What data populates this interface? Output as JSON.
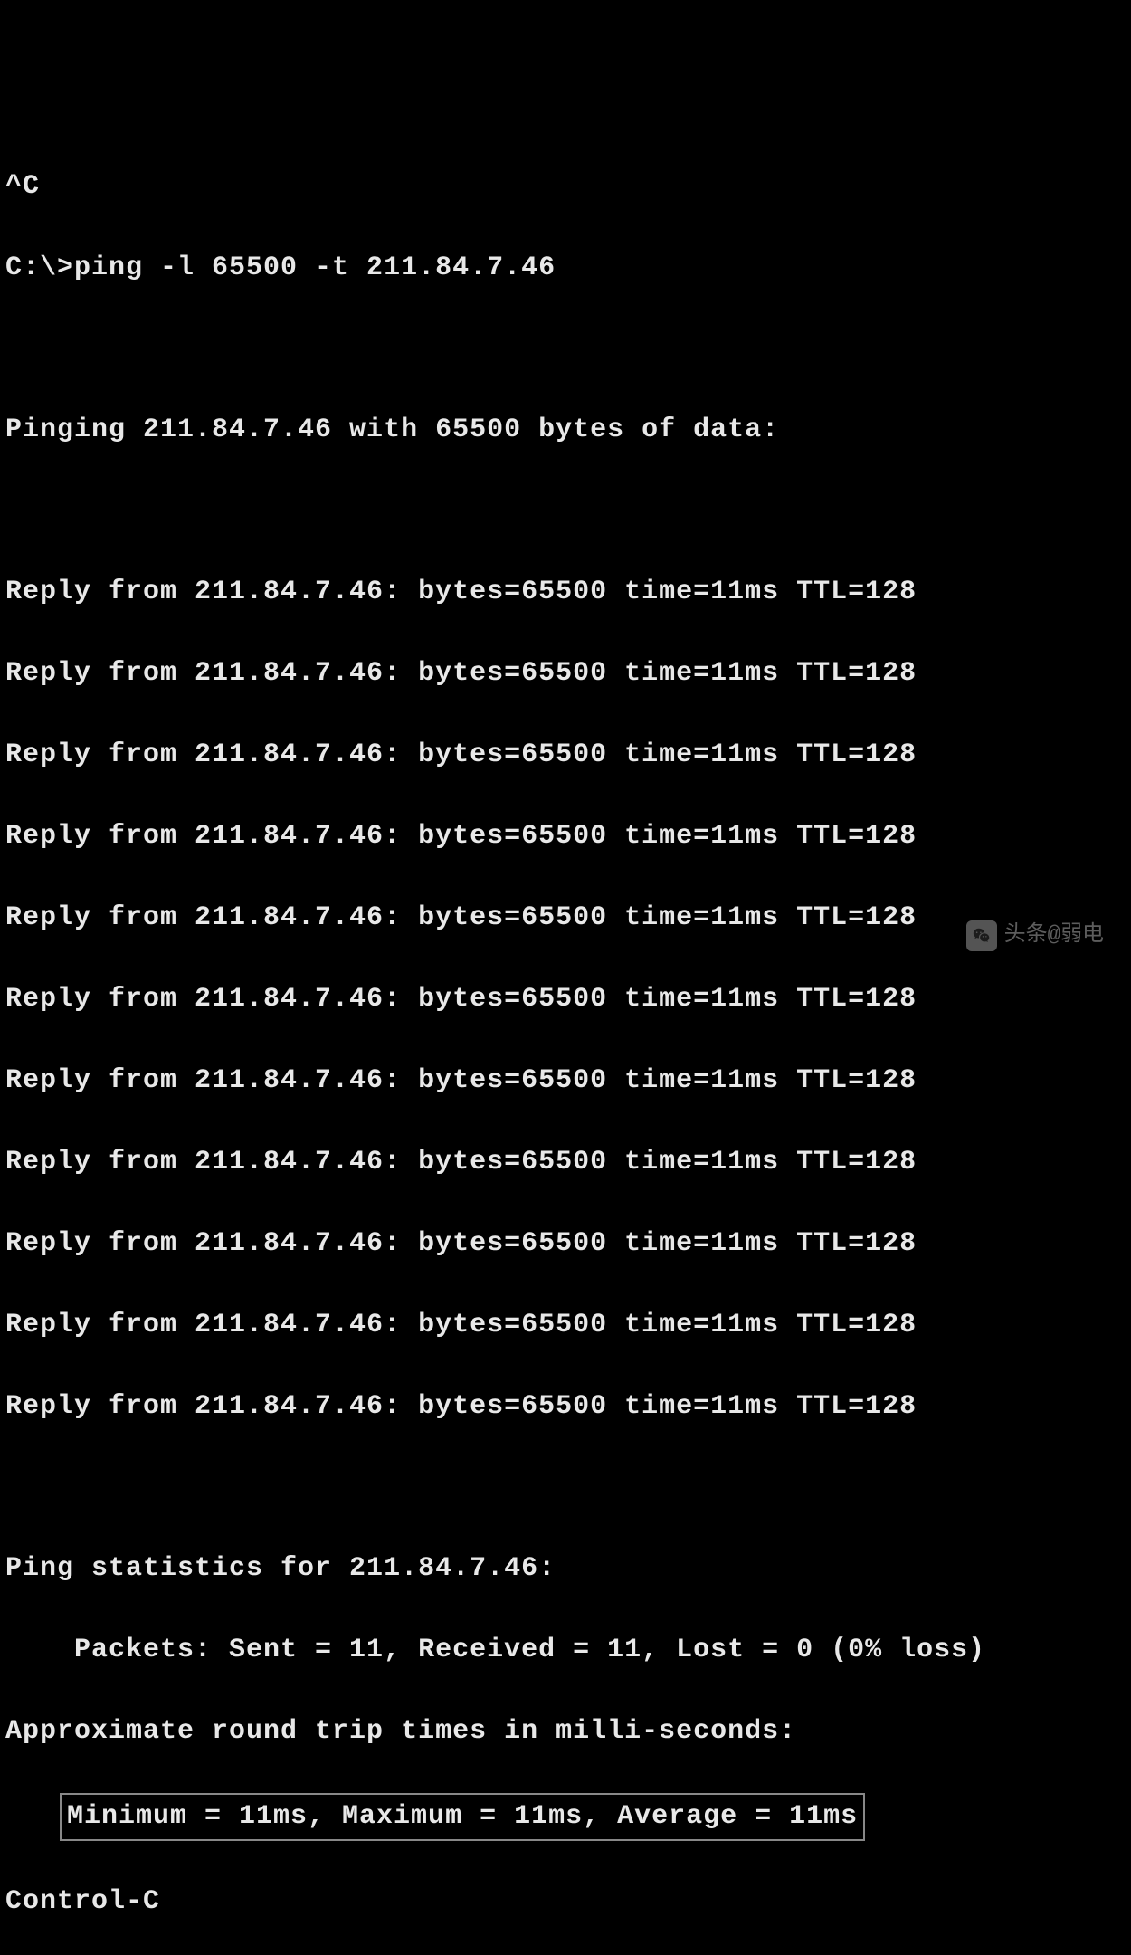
{
  "interrupt": "^C",
  "prompt": "C:\\>ping -l 65500 -t 211.84.7.46",
  "pinging_header": "Pinging 211.84.7.46 with 65500 bytes of data:",
  "replies": [
    "Reply from 211.84.7.46: bytes=65500 time=11ms TTL=128",
    "Reply from 211.84.7.46: bytes=65500 time=11ms TTL=128",
    "Reply from 211.84.7.46: bytes=65500 time=11ms TTL=128",
    "Reply from 211.84.7.46: bytes=65500 time=11ms TTL=128",
    "Reply from 211.84.7.46: bytes=65500 time=11ms TTL=128",
    "Reply from 211.84.7.46: bytes=65500 time=11ms TTL=128",
    "Reply from 211.84.7.46: bytes=65500 time=11ms TTL=128",
    "Reply from 211.84.7.46: bytes=65500 time=11ms TTL=128",
    "Reply from 211.84.7.46: bytes=65500 time=11ms TTL=128",
    "Reply from 211.84.7.46: bytes=65500 time=11ms TTL=128",
    "Reply from 211.84.7.46: bytes=65500 time=11ms TTL=128"
  ],
  "stats_header": "Ping statistics for 211.84.7.46:",
  "packets_line": "    Packets: Sent = 11, Received = 11, Lost = 0 (0% loss)",
  "rtt_header": "Approximate round trip times in milli-seconds:",
  "rtt_values": "Minimum = 11ms, Maximum = 11ms, Average = 11ms",
  "control_c": "Control-C",
  "watermark_text": "头条@弱电"
}
